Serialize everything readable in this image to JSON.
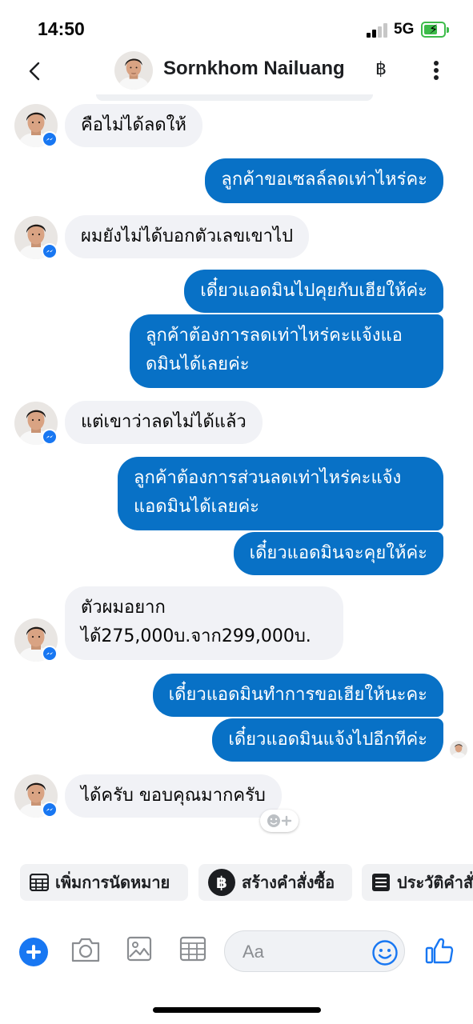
{
  "status_bar": {
    "time": "14:50",
    "network": "5G"
  },
  "header": {
    "contact_name": "Sornkhom Nailuang",
    "currency_symbol": "฿"
  },
  "messages": [
    {
      "side": "in",
      "text": "คือไม่ได้ลดให้"
    },
    {
      "side": "out",
      "text": "ลูกค้าขอเซลล์ลดเท่าไหร่คะ"
    },
    {
      "side": "in",
      "text": "ผมยังไม่ได้บอกตัวเลขเขาไป"
    },
    {
      "side": "out",
      "text": "เดี๋ยวแอดมินไปคุยกับเฮียให้ค่ะ"
    },
    {
      "side": "out",
      "line1": "ลูกค้าต้องการลดเท่าไหร่คะแจ้งแอ",
      "line2": "ดมินได้เลยค่ะ"
    },
    {
      "side": "in",
      "text": "แต่เขาว่าลดไม่ได้แล้ว"
    },
    {
      "side": "out",
      "line1": "ลูกค้าต้องการส่วนลดเท่าไหร่คะแจ้ง",
      "line2": "แอดมินได้เลยค่ะ"
    },
    {
      "side": "out",
      "text": "เดี๋ยวแอดมินจะคุยให้ค่ะ"
    },
    {
      "side": "in",
      "line1": "ตัวผมอยาก",
      "line2": "ได้275,000บ.จาก299,000บ."
    },
    {
      "side": "out",
      "text": "เดี๋ยวแอดมินทำการขอเฮียให้นะคะ"
    },
    {
      "side": "out",
      "text": "เดี๋ยวแอดมินแจ้งไปอีกทีค่ะ"
    },
    {
      "side": "in",
      "text": "ได้ครับ ขอบคุณมากครับ"
    }
  ],
  "quick_actions": [
    {
      "label": "เพิ่มการนัดหมาย",
      "icon": "calendar-grid-icon"
    },
    {
      "label": "สร้างคำสั่งซื้อ",
      "icon": "baht-circle-icon"
    },
    {
      "label": "ประวัติคำสั่งซื้อ",
      "icon": "list-document-icon"
    }
  ],
  "composer": {
    "placeholder": "Aa"
  },
  "colors": {
    "outgoing_bubble": "#0871c6",
    "incoming_bubble": "#f1f2f6",
    "accent": "#1877f2"
  }
}
